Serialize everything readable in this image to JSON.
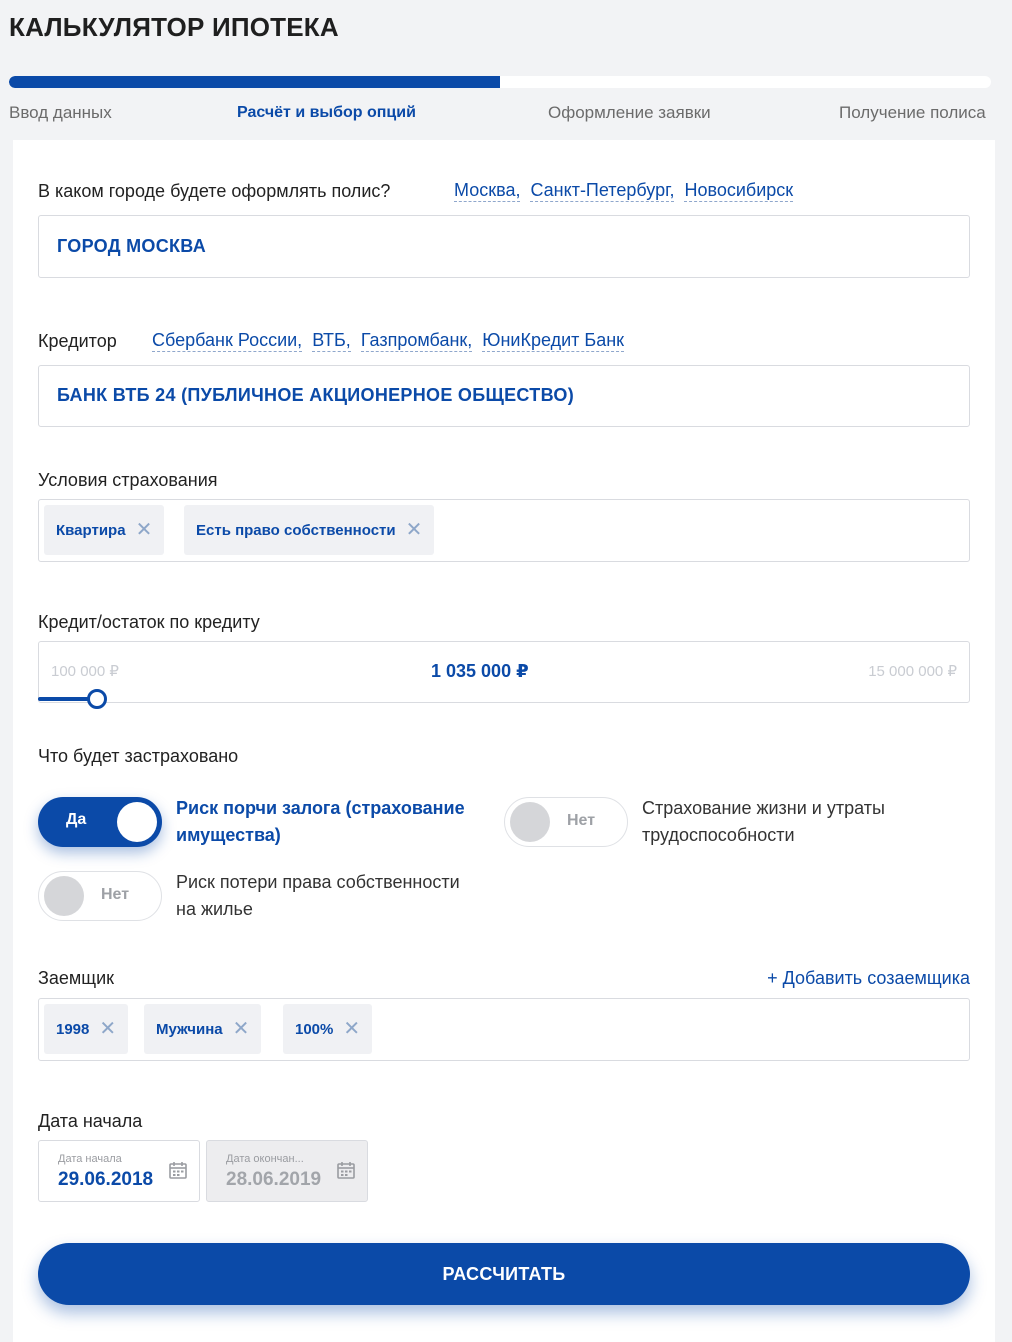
{
  "title": "КАЛЬКУЛЯТОР ИПОТЕКА",
  "progress": {
    "fraction": 0.5
  },
  "steps": [
    "Ввод данных",
    "Расчёт и выбор опций",
    "Оформление заявки",
    "Получение полиса"
  ],
  "city": {
    "question": "В каком городе будете оформлять полис?",
    "links": [
      "Москва,",
      "Санкт-Петербург,",
      "Новосибирск"
    ],
    "value": "ГОРОД МОСКВА"
  },
  "creditor": {
    "label": "Кредитор",
    "links": [
      "Сбербанк России,",
      "ВТБ,",
      "Газпромбанк,",
      "ЮниКредит Банк"
    ],
    "value": "БАНК ВТБ 24 (ПУБЛИЧНОЕ АКЦИОНЕРНОЕ ОБЩЕСТВО)"
  },
  "conditions": {
    "label": "Условия страхования",
    "chips": [
      "Квартира",
      "Есть право собственности"
    ]
  },
  "credit": {
    "label": "Кредит/остаток по кредиту",
    "min": "100 000 ₽",
    "value": "1 035 000  ₽",
    "max": "15 000 000 ₽"
  },
  "insured": {
    "label": "Что будет застраховано",
    "toggles": [
      {
        "state": "Да",
        "caption_line1": "Риск порчи залога (страхование",
        "caption_line2": "имущества)"
      },
      {
        "state": "Нет",
        "caption_line1": "Страхование жизни и утраты",
        "caption_line2": "трудоспособности"
      },
      {
        "state": "Нет",
        "caption_line1": "Риск потери права собственности",
        "caption_line2": "на жилье"
      }
    ]
  },
  "borrower": {
    "label": "Заемщик",
    "add_link": "+ Добавить созаемщика",
    "chips": [
      "1998",
      "Мужчина",
      "100%"
    ]
  },
  "dates": {
    "label": "Дата начала",
    "start_label": "Дата начала",
    "start_value": "29.06.2018",
    "end_label": "Дата окончан...",
    "end_value": "28.06.2019"
  },
  "button": "РАССЧИТАТЬ",
  "colors": {
    "accent": "#0b4aa8"
  }
}
